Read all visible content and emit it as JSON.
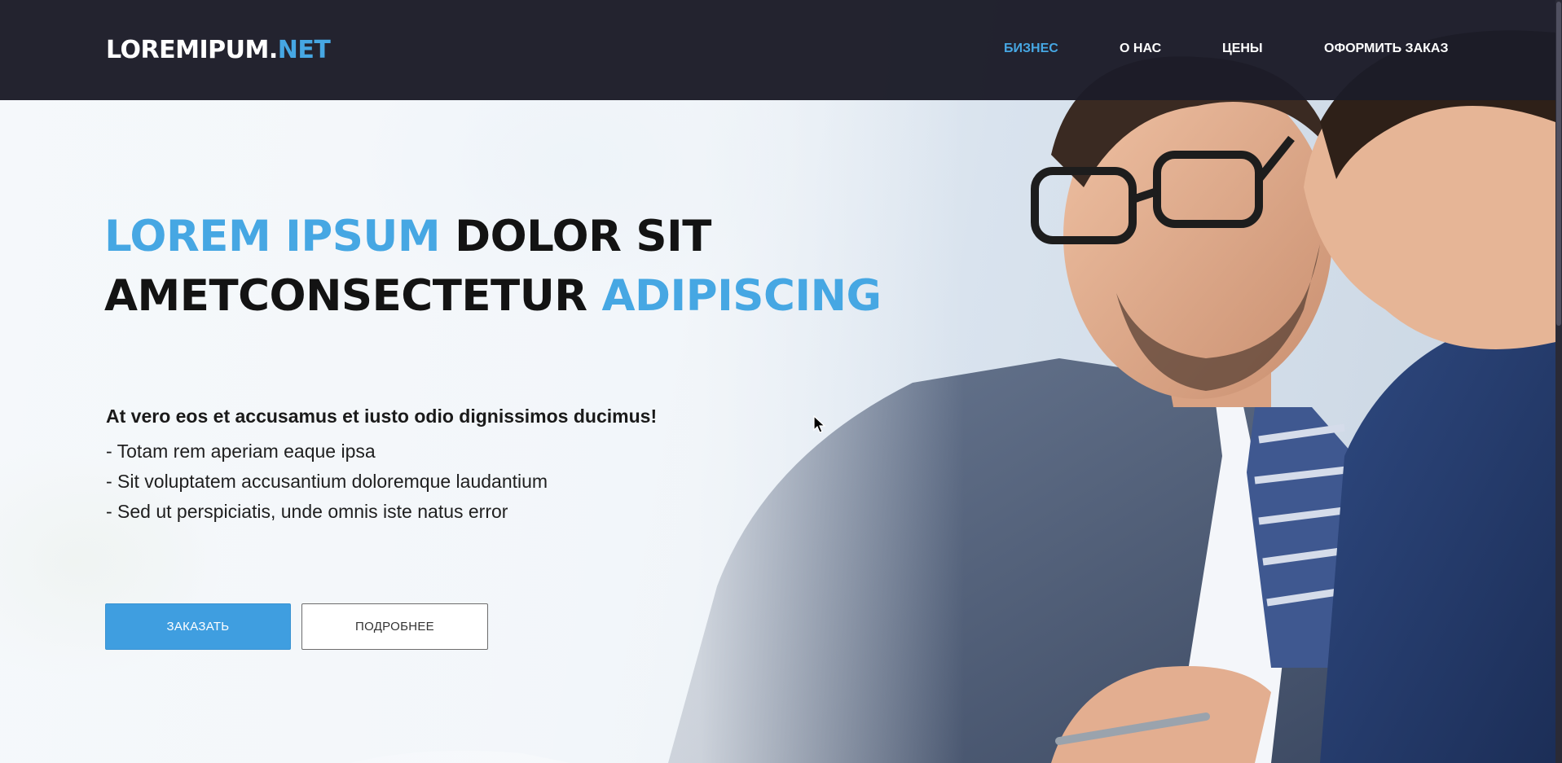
{
  "header": {
    "logo_main": "LOREMIPUM.",
    "logo_accent": "NET",
    "nav": [
      {
        "label": "БИЗНЕС",
        "active": true
      },
      {
        "label": "О НАС",
        "active": false
      },
      {
        "label": "ЦЕНЫ",
        "active": false
      },
      {
        "label": "ОФОРМИТЬ ЗАКАЗ",
        "active": false
      }
    ]
  },
  "hero": {
    "headline": {
      "part1": "LOREM IPSUM",
      "part2": "DOLOR SIT",
      "part3": "AMETCONSECTETUR",
      "part4": "ADIPISCING"
    },
    "lead": "At vero eos et accusamus et iusto odio dignissimos ducimus!",
    "bullets": [
      "- Totam rem aperiam eaque ipsa",
      "- Sit voluptatem accusantium doloremque laudantium",
      "- Sed ut perspiciatis, unde omnis iste natus error"
    ],
    "primary_button": "ЗАКАЗАТЬ",
    "secondary_button": "ПОДРОБНЕЕ",
    "photo": "business-men-photo"
  },
  "colors": {
    "accent": "#46a7e3",
    "header_bg": "#1c1c28",
    "button_primary": "#3f9ee0",
    "headline_dark": "#131313"
  }
}
